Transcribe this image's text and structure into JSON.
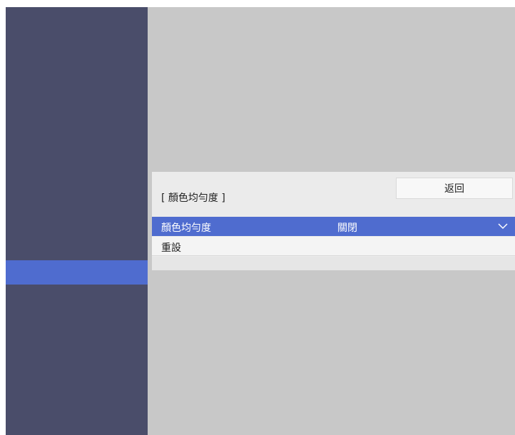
{
  "panel": {
    "title": "[ 顏色均勻度 ]",
    "back_label": "返回"
  },
  "rows": [
    {
      "label": "顏色均勻度",
      "value": "關閉",
      "icon": "chevron-down-icon",
      "selected": true
    },
    {
      "label": "重設",
      "selected": false
    }
  ],
  "colors": {
    "sidebar": "#4a4d6a",
    "highlight": "#4f6ccf",
    "background": "#c8c8c8",
    "panel": "#ebebeb"
  }
}
